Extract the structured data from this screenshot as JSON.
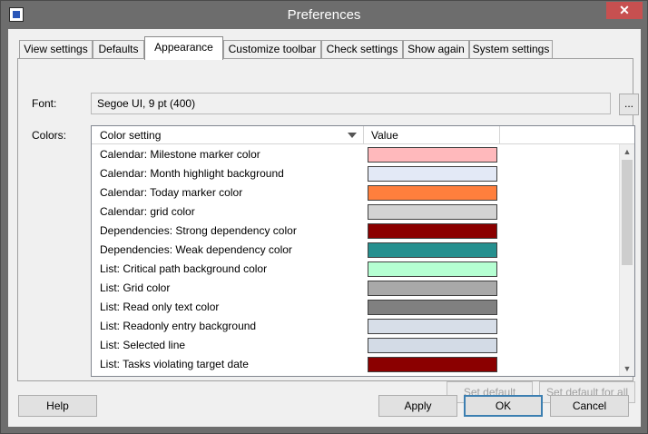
{
  "window": {
    "title": "Preferences",
    "close_glyph": "✕"
  },
  "tabs": [
    {
      "label": "View settings"
    },
    {
      "label": "Defaults"
    },
    {
      "label": "Appearance"
    },
    {
      "label": "Customize toolbar"
    },
    {
      "label": "Check settings"
    },
    {
      "label": "Show again"
    },
    {
      "label": "System settings"
    }
  ],
  "active_tab": "Appearance",
  "font": {
    "label": "Font:",
    "value": "Segoe UI, 9 pt (400)",
    "browse_label": "..."
  },
  "colors": {
    "label": "Colors:",
    "columns": {
      "setting": "Color setting",
      "value": "Value"
    },
    "rows": [
      {
        "name": "Calendar: Milestone marker color",
        "color": "#ffb9bc"
      },
      {
        "name": "Calendar: Month highlight background",
        "color": "#e3e9f6"
      },
      {
        "name": "Calendar: Today marker color",
        "color": "#ff7f3d"
      },
      {
        "name": "Calendar: grid color",
        "color": "#d3d3d3"
      },
      {
        "name": "Dependencies: Strong dependency color",
        "color": "#8b0000"
      },
      {
        "name": "Dependencies: Weak dependency color",
        "color": "#26908f"
      },
      {
        "name": "List: Critical path background color",
        "color": "#b5ffd2"
      },
      {
        "name": "List: Grid color",
        "color": "#a9a9a9"
      },
      {
        "name": "List: Read only text color",
        "color": "#808080"
      },
      {
        "name": "List: Readonly entry background",
        "color": "#d7dee8"
      },
      {
        "name": "List: Selected line",
        "color": "#d3dbe6"
      },
      {
        "name": "List: Tasks violating target date",
        "color": "#8b0000"
      },
      {
        "name": "",
        "color": "#000000"
      }
    ]
  },
  "buttons": {
    "set_default": "Set default",
    "set_default_all": "Set default for all",
    "help": "Help",
    "apply": "Apply",
    "ok": "OK",
    "cancel": "Cancel"
  },
  "scroll": {
    "up": "▲",
    "down": "▼"
  }
}
